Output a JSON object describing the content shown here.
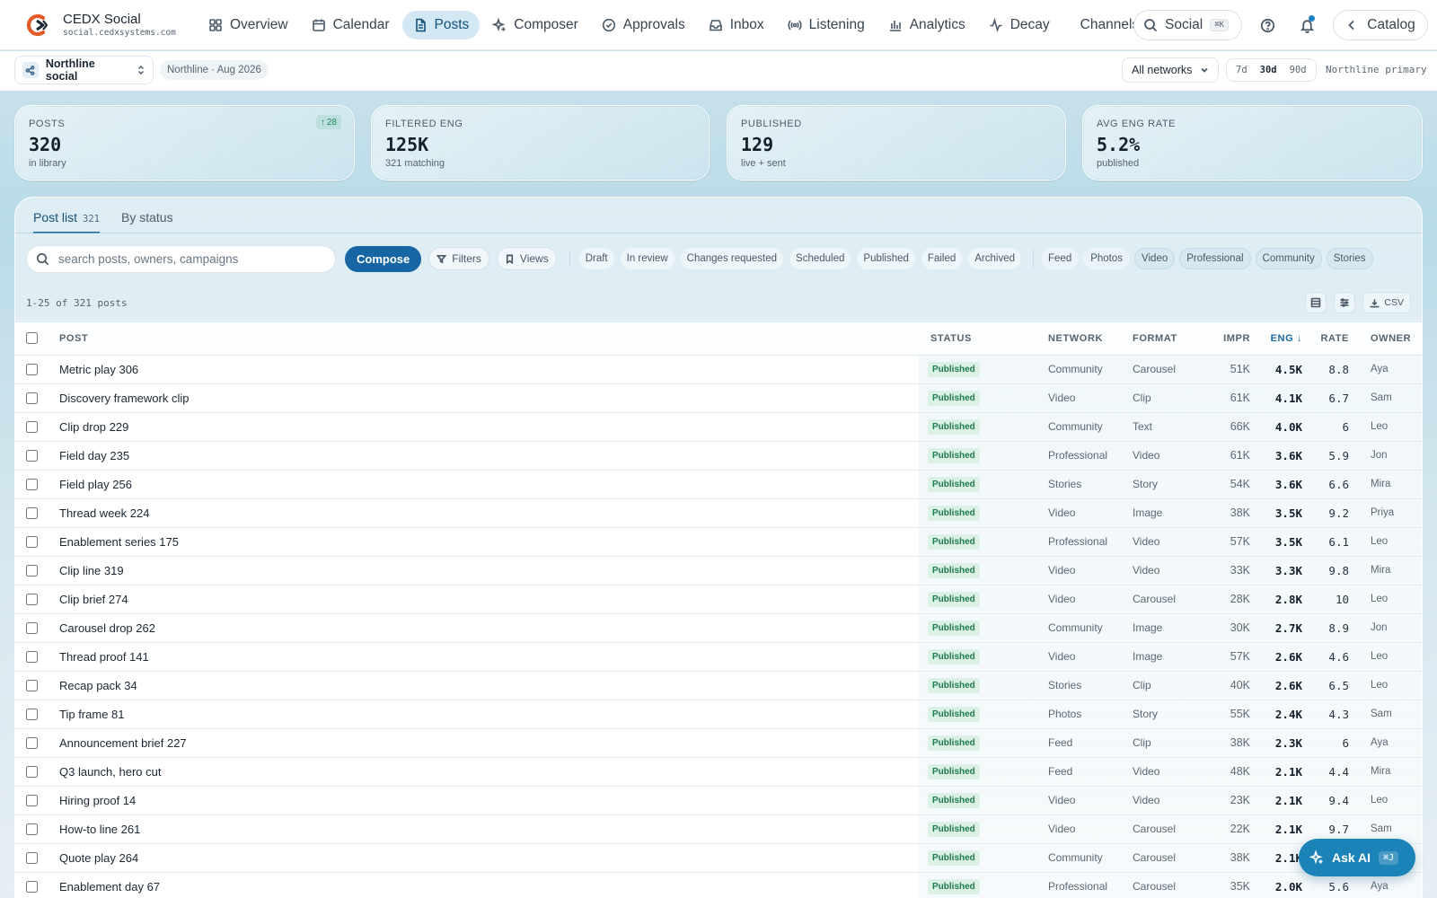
{
  "brand": {
    "name": "CEDX Social",
    "domain": "social.cedxsystems.com"
  },
  "nav": {
    "items": [
      {
        "label": "Overview",
        "icon": "grid-icon"
      },
      {
        "label": "Calendar",
        "icon": "calendar-icon"
      },
      {
        "label": "Posts",
        "icon": "document-icon",
        "active": true
      },
      {
        "label": "Composer",
        "icon": "sparkle-icon"
      },
      {
        "label": "Approvals",
        "icon": "check-circle-icon"
      },
      {
        "label": "Inbox",
        "icon": "inbox-icon"
      },
      {
        "label": "Listening",
        "icon": "broadcast-icon"
      },
      {
        "label": "Analytics",
        "icon": "bar-chart-icon"
      },
      {
        "label": "Decay",
        "icon": "activity-icon"
      },
      {
        "label": "Channels",
        "icon": "share-icon"
      }
    ],
    "search_label": "Social",
    "search_kbd": "⌘K",
    "catalog_label": "Catalog"
  },
  "subbar": {
    "workspace": "Northline social",
    "context": "Northline · Aug 2026",
    "network_filter": "All networks",
    "ranges": [
      "7d",
      "30d",
      "90d"
    ],
    "active_range": "30d",
    "brand_kit": "Northline primary"
  },
  "kpis": [
    {
      "label": "Posts",
      "value": "320",
      "sub": "in library",
      "badge": "28"
    },
    {
      "label": "Filtered eng",
      "value": "125K",
      "sub": "321 matching"
    },
    {
      "label": "Published",
      "value": "129",
      "sub": "live + sent"
    },
    {
      "label": "Avg eng rate",
      "value": "5.2%",
      "sub": "published"
    }
  ],
  "tabs": [
    {
      "label": "Post list",
      "count": "321",
      "active": true
    },
    {
      "label": "By status"
    }
  ],
  "toolbar": {
    "search_placeholder": "search posts, owners, campaigns",
    "compose": "Compose",
    "filters": "Filters",
    "views": "Views",
    "status_chips": [
      "Draft",
      "In review",
      "Changes requested",
      "Scheduled",
      "Published",
      "Failed",
      "Archived"
    ],
    "format_chips": [
      {
        "label": "Feed",
        "selected": false
      },
      {
        "label": "Photos",
        "selected": false
      },
      {
        "label": "Video",
        "selected": true
      },
      {
        "label": "Professional",
        "selected": true
      },
      {
        "label": "Community",
        "selected": true
      },
      {
        "label": "Stories",
        "selected": true
      }
    ]
  },
  "results": {
    "summary": "1-25 of 321 posts",
    "csv": "CSV"
  },
  "table": {
    "columns": {
      "post": "Post",
      "status": "Status",
      "network": "Network",
      "format": "Format",
      "impr": "Impr",
      "eng": "Eng",
      "rate": "Rate",
      "owner": "Owner"
    },
    "sort_indicator": "↓",
    "rows": [
      {
        "post": "Metric play 306",
        "status": "Published",
        "network": "Community",
        "format": "Carousel",
        "impr": "51K",
        "eng": "4.5K",
        "rate": "8.8",
        "owner": "Aya"
      },
      {
        "post": "Discovery framework clip",
        "status": "Published",
        "network": "Video",
        "format": "Clip",
        "impr": "61K",
        "eng": "4.1K",
        "rate": "6.7",
        "owner": "Sam"
      },
      {
        "post": "Clip drop 229",
        "status": "Published",
        "network": "Community",
        "format": "Text",
        "impr": "66K",
        "eng": "4.0K",
        "rate": "6",
        "owner": "Leo"
      },
      {
        "post": "Field day 235",
        "status": "Published",
        "network": "Professional",
        "format": "Video",
        "impr": "61K",
        "eng": "3.6K",
        "rate": "5.9",
        "owner": "Jon"
      },
      {
        "post": "Field play 256",
        "status": "Published",
        "network": "Stories",
        "format": "Story",
        "impr": "54K",
        "eng": "3.6K",
        "rate": "6.6",
        "owner": "Mira"
      },
      {
        "post": "Thread week 224",
        "status": "Published",
        "network": "Video",
        "format": "Image",
        "impr": "38K",
        "eng": "3.5K",
        "rate": "9.2",
        "owner": "Priya"
      },
      {
        "post": "Enablement series 175",
        "status": "Published",
        "network": "Professional",
        "format": "Video",
        "impr": "57K",
        "eng": "3.5K",
        "rate": "6.1",
        "owner": "Leo"
      },
      {
        "post": "Clip line 319",
        "status": "Published",
        "network": "Video",
        "format": "Video",
        "impr": "33K",
        "eng": "3.3K",
        "rate": "9.8",
        "owner": "Mira"
      },
      {
        "post": "Clip brief 274",
        "status": "Published",
        "network": "Video",
        "format": "Carousel",
        "impr": "28K",
        "eng": "2.8K",
        "rate": "10",
        "owner": "Leo"
      },
      {
        "post": "Carousel drop 262",
        "status": "Published",
        "network": "Community",
        "format": "Image",
        "impr": "30K",
        "eng": "2.7K",
        "rate": "8.9",
        "owner": "Jon"
      },
      {
        "post": "Thread proof 141",
        "status": "Published",
        "network": "Video",
        "format": "Image",
        "impr": "57K",
        "eng": "2.6K",
        "rate": "4.6",
        "owner": "Leo"
      },
      {
        "post": "Recap pack 34",
        "status": "Published",
        "network": "Stories",
        "format": "Clip",
        "impr": "40K",
        "eng": "2.6K",
        "rate": "6.5",
        "owner": "Leo"
      },
      {
        "post": "Tip frame 81",
        "status": "Published",
        "network": "Photos",
        "format": "Story",
        "impr": "55K",
        "eng": "2.4K",
        "rate": "4.3",
        "owner": "Sam"
      },
      {
        "post": "Announcement brief 227",
        "status": "Published",
        "network": "Feed",
        "format": "Clip",
        "impr": "38K",
        "eng": "2.3K",
        "rate": "6",
        "owner": "Aya"
      },
      {
        "post": "Q3 launch, hero cut",
        "status": "Published",
        "network": "Feed",
        "format": "Video",
        "impr": "48K",
        "eng": "2.1K",
        "rate": "4.4",
        "owner": "Mira"
      },
      {
        "post": "Hiring proof 14",
        "status": "Published",
        "network": "Video",
        "format": "Video",
        "impr": "23K",
        "eng": "2.1K",
        "rate": "9.4",
        "owner": "Leo"
      },
      {
        "post": "How-to line 261",
        "status": "Published",
        "network": "Video",
        "format": "Carousel",
        "impr": "22K",
        "eng": "2.1K",
        "rate": "9.7",
        "owner": "Sam"
      },
      {
        "post": "Quote play 264",
        "status": "Published",
        "network": "Community",
        "format": "Carousel",
        "impr": "38K",
        "eng": "2.1K",
        "rate": "",
        "owner": ""
      },
      {
        "post": "Enablement day 67",
        "status": "Published",
        "network": "Professional",
        "format": "Carousel",
        "impr": "35K",
        "eng": "2.0K",
        "rate": "5.6",
        "owner": "Aya"
      }
    ]
  },
  "ask_ai": {
    "label": "Ask AI",
    "kbd": "⌘J"
  },
  "colors": {
    "accent": "#1766a3",
    "published_bg": "#dcf1e5",
    "published_fg": "#1f7a4d",
    "ask_ai": "#1b83b7"
  }
}
